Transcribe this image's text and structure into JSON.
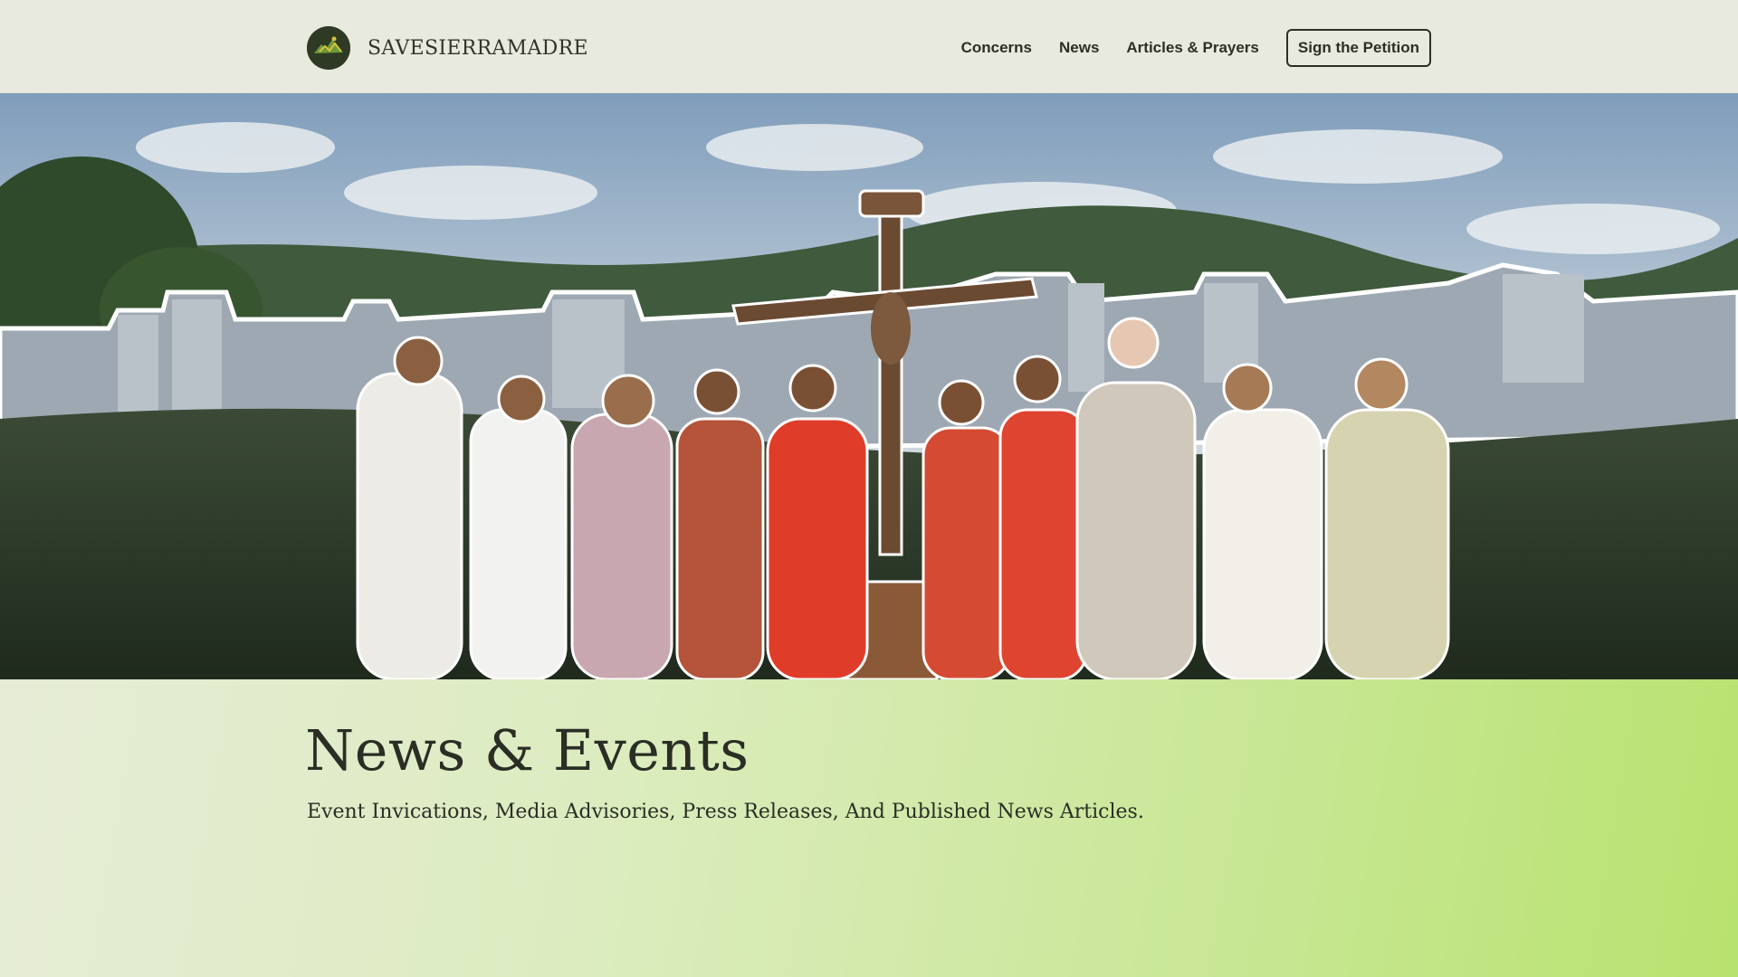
{
  "header": {
    "brand_name": "SAVESIERRAMADRE",
    "logo_icon": "mountain-logo-icon",
    "nav": [
      {
        "label": "Concerns"
      },
      {
        "label": "News"
      },
      {
        "label": "Articles & Prayers"
      }
    ],
    "petition_label": "Sign the Petition"
  },
  "hero": {
    "image": "hero-photo-group-with-crucifix-over-city-skyline"
  },
  "news": {
    "title": "News & Events",
    "subtitle": "Event Invications, Media Advisories, Press Releases, And Published News Articles."
  },
  "colors": {
    "header_bg": "#e8e9df",
    "text_dark": "#2b2f26",
    "gradient_start": "#e6ecd6",
    "gradient_end": "#b8e26f"
  }
}
